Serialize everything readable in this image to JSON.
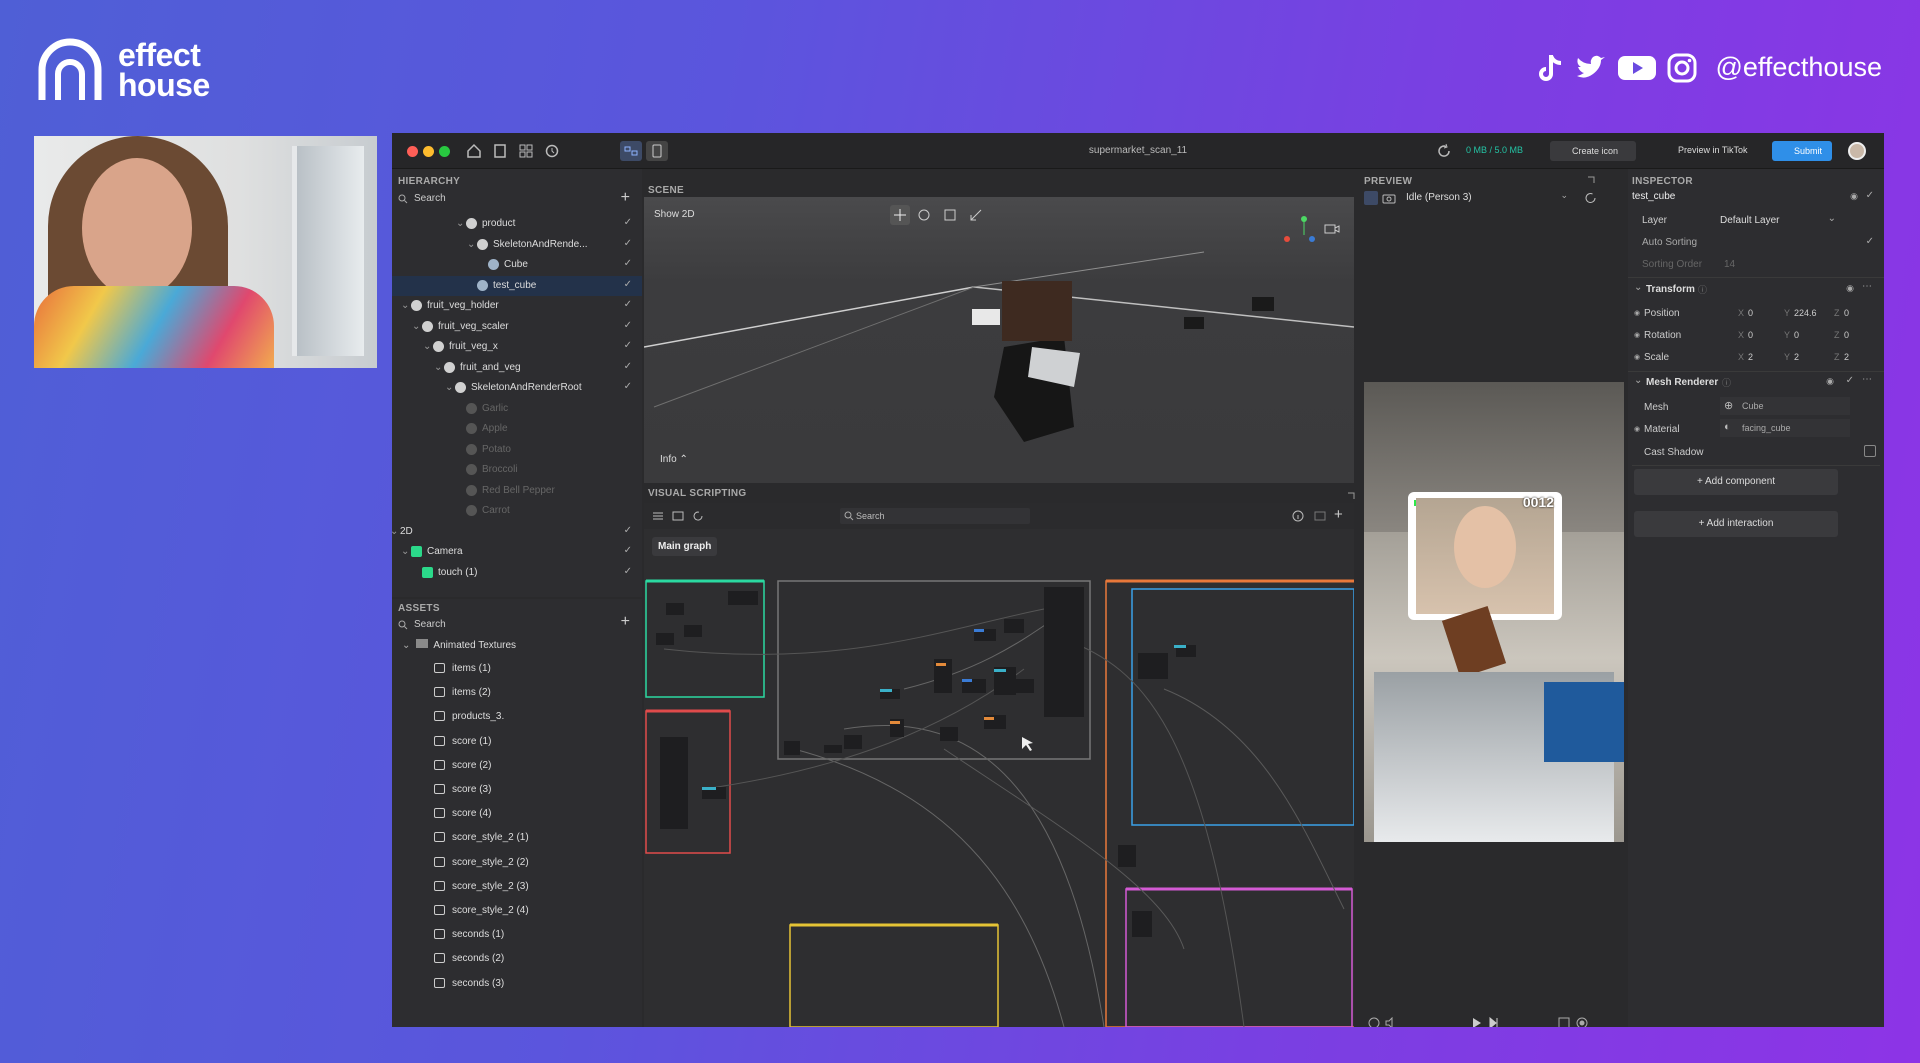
{
  "brand": {
    "name_line1": "effect",
    "name_line2": "house",
    "social_handle": "@effecthouse"
  },
  "social_icons": [
    "tiktok-icon",
    "twitter-icon",
    "youtube-icon",
    "instagram-icon"
  ],
  "window": {
    "title": "supermarket_scan_11",
    "memory": "0 MB / 5.0 MB",
    "create_icon": "Create icon",
    "preview_in_tiktok": "Preview in TikTok",
    "submit": "Submit"
  },
  "hierarchy": {
    "title": "HIERARCHY",
    "search": "Search",
    "items": [
      {
        "label": "product",
        "level": 6,
        "icon": "object",
        "dim": false
      },
      {
        "label": "SkeletonAndRende...",
        "level": 7,
        "icon": "object",
        "dim": false
      },
      {
        "label": "Cube",
        "level": 8,
        "icon": "mesh",
        "dim": false
      },
      {
        "label": "test_cube",
        "level": 7,
        "icon": "mesh",
        "dim": false,
        "selected": true
      },
      {
        "label": "fruit_veg_holder",
        "level": 1,
        "icon": "object",
        "dim": false
      },
      {
        "label": "fruit_veg_scaler",
        "level": 2,
        "icon": "object",
        "dim": false
      },
      {
        "label": "fruit_veg_x",
        "level": 3,
        "icon": "object",
        "dim": false
      },
      {
        "label": "fruit_and_veg",
        "level": 4,
        "icon": "object",
        "dim": false
      },
      {
        "label": "SkeletonAndRenderRoot",
        "level": 5,
        "icon": "object",
        "dim": false
      },
      {
        "label": "Garlic",
        "level": 6,
        "icon": "mesh",
        "dim": true
      },
      {
        "label": "Apple",
        "level": 6,
        "icon": "mesh",
        "dim": true
      },
      {
        "label": "Potato",
        "level": 6,
        "icon": "mesh",
        "dim": true
      },
      {
        "label": "Broccoli",
        "level": 6,
        "icon": "mesh",
        "dim": true
      },
      {
        "label": "Red Bell Pepper",
        "level": 6,
        "icon": "mesh",
        "dim": true
      },
      {
        "label": "Carrot",
        "level": 6,
        "icon": "mesh",
        "dim": true
      },
      {
        "label": "2D",
        "level": 0,
        "icon": "none",
        "dim": false
      },
      {
        "label": "Camera",
        "level": 1,
        "icon": "camera",
        "dim": false
      },
      {
        "label": "touch (1)",
        "level": 2,
        "icon": "touch",
        "dim": false
      }
    ]
  },
  "assets": {
    "title": "ASSETS",
    "search": "Search",
    "folder": "Animated Textures",
    "items": [
      "items (1)",
      "items (2)",
      "products_3.",
      "score (1)",
      "score (2)",
      "score (3)",
      "score (4)",
      "score_style_2 (1)",
      "score_style_2 (2)",
      "score_style_2 (3)",
      "score_style_2 (4)",
      "seconds (1)",
      "seconds (2)",
      "seconds (3)"
    ]
  },
  "scene": {
    "title": "SCENE",
    "show2d": "Show 2D",
    "info": "Info"
  },
  "visual_scripting": {
    "title": "VISUAL SCRIPTING",
    "search": "Search",
    "main_graph": "Main graph"
  },
  "preview": {
    "title": "PREVIEW",
    "person": "Idle (Person 3)",
    "score": "0012"
  },
  "inspector": {
    "title": "INSPECTOR",
    "object_name": "test_cube",
    "layer_label": "Layer",
    "layer_value": "Default Layer",
    "auto_sorting": "Auto Sorting",
    "sorting_order": "Sorting Order",
    "sorting_value": "14",
    "transform": "Transform",
    "position": "Position",
    "pos_x": "0",
    "pos_y": "224.6",
    "pos_z": "0",
    "rotation": "Rotation",
    "rot_x": "0",
    "rot_y": "0",
    "rot_z": "0",
    "scale": "Scale",
    "scl_x": "2",
    "scl_y": "2",
    "scl_z": "2",
    "x": "X",
    "y": "Y",
    "z": "Z",
    "mesh_renderer": "Mesh Renderer",
    "mesh": "Mesh",
    "mesh_value": "Cube",
    "material": "Material",
    "material_value": "facing_cube",
    "cast_shadow": "Cast Shadow",
    "add_component": "+ Add component",
    "add_interaction": "+ Add interaction"
  },
  "colors": {
    "accent": "#2f8fe8",
    "memory": "#24c3a4",
    "submit": "#2f8fe8"
  }
}
